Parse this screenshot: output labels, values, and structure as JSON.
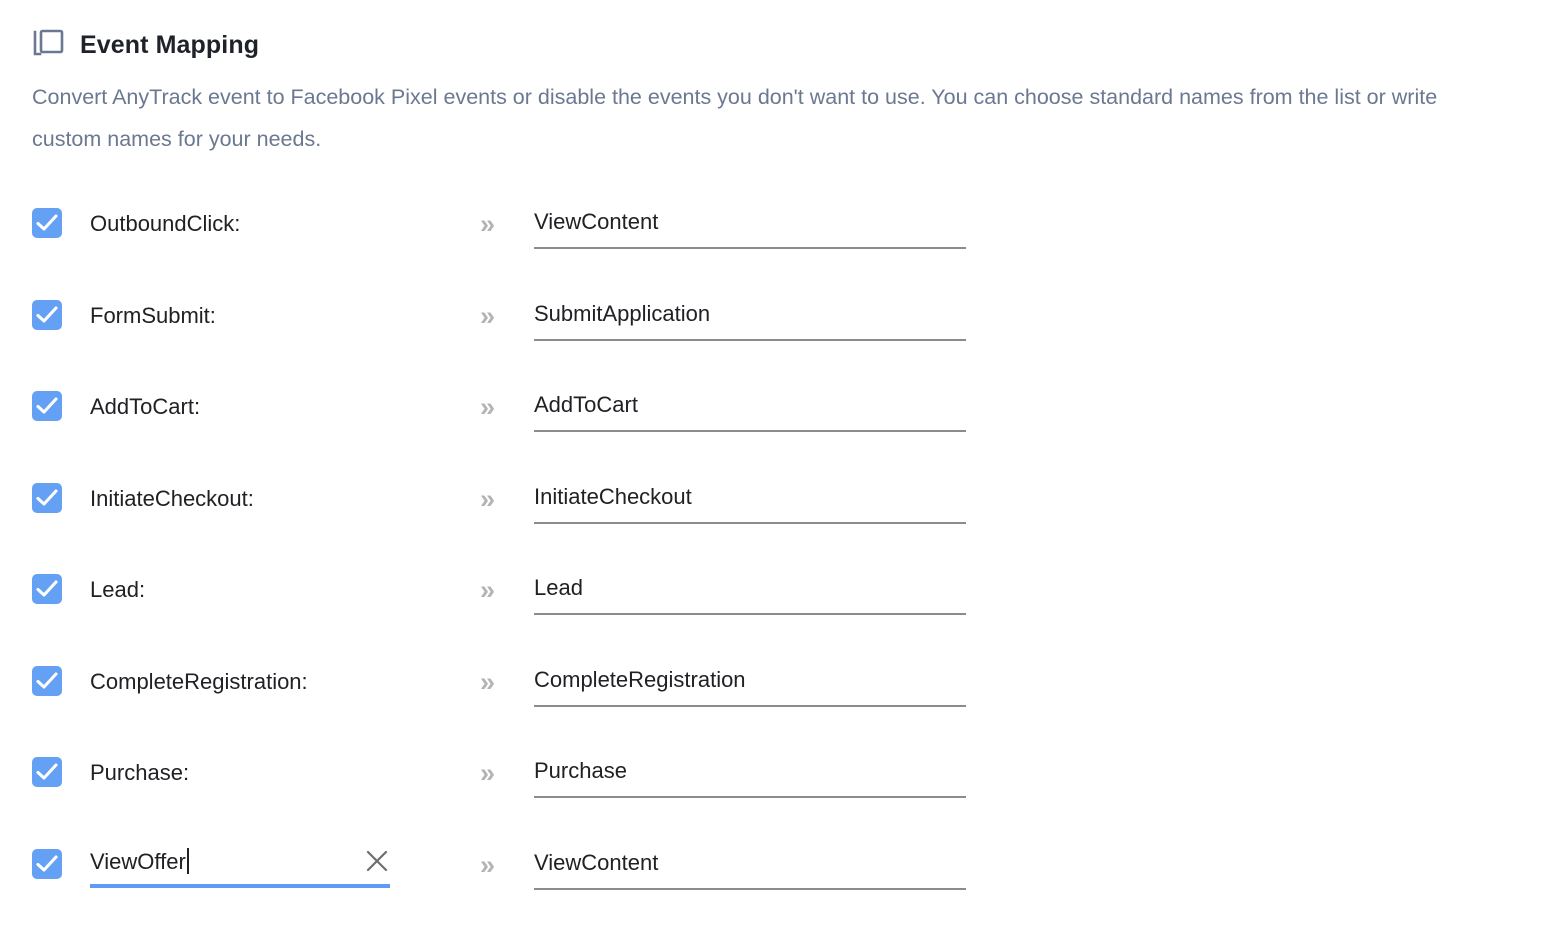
{
  "header": {
    "icon": "layers-icon",
    "title": "Event Mapping",
    "description": "Convert AnyTrack event to Facebook Pixel events or disable the events you don't want to use. You can choose standard names from the list or write custom names for your needs."
  },
  "colors": {
    "checkbox_blue": "#64a0f4",
    "focus_underline_blue": "#5e9bf5",
    "underline_gray": "#8c8c8c",
    "chevron_gray": "#b4b4b4",
    "title_text": "#1f2329",
    "description_text": "#6b7891",
    "body_text": "#202124",
    "background": "#ffffff"
  },
  "icons": {
    "chevron": "»",
    "clear": "clear-icon",
    "check": "check-icon"
  },
  "rows": [
    {
      "checked": true,
      "source_label": "OutboundClick:",
      "source_editable": false,
      "target_value": "ViewContent",
      "focused": false,
      "clearable": false
    },
    {
      "checked": true,
      "source_label": "FormSubmit:",
      "source_editable": false,
      "target_value": "SubmitApplication",
      "focused": false,
      "clearable": false
    },
    {
      "checked": true,
      "source_label": "AddToCart:",
      "source_editable": false,
      "target_value": "AddToCart",
      "focused": false,
      "clearable": false
    },
    {
      "checked": true,
      "source_label": "InitiateCheckout:",
      "source_editable": false,
      "target_value": "InitiateCheckout",
      "focused": false,
      "clearable": false
    },
    {
      "checked": true,
      "source_label": "Lead:",
      "source_editable": false,
      "target_value": "Lead",
      "focused": false,
      "clearable": false
    },
    {
      "checked": true,
      "source_label": "CompleteRegistration:",
      "source_editable": false,
      "target_value": "CompleteRegistration",
      "focused": false,
      "clearable": false
    },
    {
      "checked": true,
      "source_label": "Purchase:",
      "source_editable": false,
      "target_value": "Purchase",
      "focused": false,
      "clearable": false
    },
    {
      "checked": true,
      "source_label": "ViewOffer",
      "source_editable": true,
      "target_value": "ViewContent",
      "focused": true,
      "clearable": true
    }
  ]
}
